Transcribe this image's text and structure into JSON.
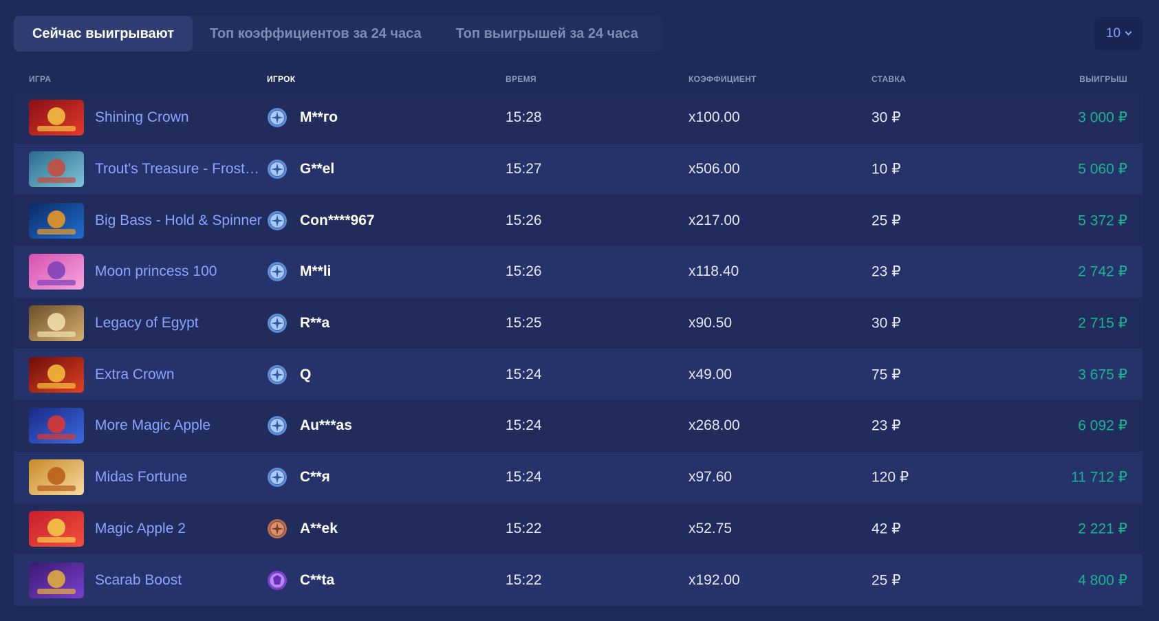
{
  "tabs": [
    {
      "label": "Сейчас выигрывают",
      "active": true
    },
    {
      "label": "Топ коэффициентов за 24 часа",
      "active": false
    },
    {
      "label": "Топ выигрышей за 24 часа",
      "active": false
    }
  ],
  "count_select": {
    "value": "10"
  },
  "columns": {
    "game": "ИГРА",
    "player": "ИГРОК",
    "time": "ВРЕМЯ",
    "coef": "КОЭФФИЦИЕНТ",
    "bet": "СТАВКА",
    "win": "ВЫИГРЫШ"
  },
  "rows": [
    {
      "game": "Shining Crown",
      "player": "M**го",
      "time": "15:28",
      "coef": "x100.00",
      "bet": "30 ₽",
      "win": "3 000 ₽",
      "avatar": "blue-compass-avatar-icon",
      "thumb": "shining-crown-thumbnail"
    },
    {
      "game": "Trout's Treasure - Frost…",
      "player": "G**el",
      "time": "15:27",
      "coef": "x506.00",
      "bet": "10 ₽",
      "win": "5 060 ₽",
      "avatar": "blue-compass-avatar-icon",
      "thumb": "trouts-treasure-thumbnail"
    },
    {
      "game": "Big Bass - Hold & Spinner",
      "player": "Con****967",
      "time": "15:26",
      "coef": "x217.00",
      "bet": "25 ₽",
      "win": "5 372 ₽",
      "avatar": "blue-compass-avatar-icon",
      "thumb": "big-bass-thumbnail"
    },
    {
      "game": "Moon princess 100",
      "player": "M**li",
      "time": "15:26",
      "coef": "x118.40",
      "bet": "23 ₽",
      "win": "2 742 ₽",
      "avatar": "blue-compass-avatar-icon",
      "thumb": "moon-princess-thumbnail"
    },
    {
      "game": "Legacy of Egypt",
      "player": "R**a",
      "time": "15:25",
      "coef": "x90.50",
      "bet": "30 ₽",
      "win": "2 715 ₽",
      "avatar": "blue-compass-avatar-icon",
      "thumb": "legacy-of-egypt-thumbnail"
    },
    {
      "game": "Extra Crown",
      "player": "Q",
      "time": "15:24",
      "coef": "x49.00",
      "bet": "75 ₽",
      "win": "3 675 ₽",
      "avatar": "blue-compass-avatar-icon",
      "thumb": "extra-crown-thumbnail"
    },
    {
      "game": "More Magic Apple",
      "player": "Au***as",
      "time": "15:24",
      "coef": "x268.00",
      "bet": "23 ₽",
      "win": "6 092 ₽",
      "avatar": "blue-compass-avatar-icon",
      "thumb": "more-magic-apple-thumbnail"
    },
    {
      "game": "Midas Fortune",
      "player": "C**я",
      "time": "15:24",
      "coef": "x97.60",
      "bet": "120 ₽",
      "win": "11 712 ₽",
      "avatar": "blue-compass-avatar-icon",
      "thumb": "midas-fortune-thumbnail"
    },
    {
      "game": "Magic Apple 2",
      "player": "A**ek",
      "time": "15:22",
      "coef": "x52.75",
      "bet": "42 ₽",
      "win": "2 221 ₽",
      "avatar": "bronze-compass-avatar-icon",
      "thumb": "magic-apple-2-thumbnail"
    },
    {
      "game": "Scarab Boost",
      "player": "C**ta",
      "time": "15:22",
      "coef": "x192.00",
      "bet": "25 ₽",
      "win": "4 800 ₽",
      "avatar": "purple-gem-avatar-icon",
      "thumb": "scarab-boost-thumbnail"
    }
  ],
  "colors": {
    "background": "#1e2a57",
    "accent": "#8aa4ff",
    "win": "#1cb391"
  }
}
